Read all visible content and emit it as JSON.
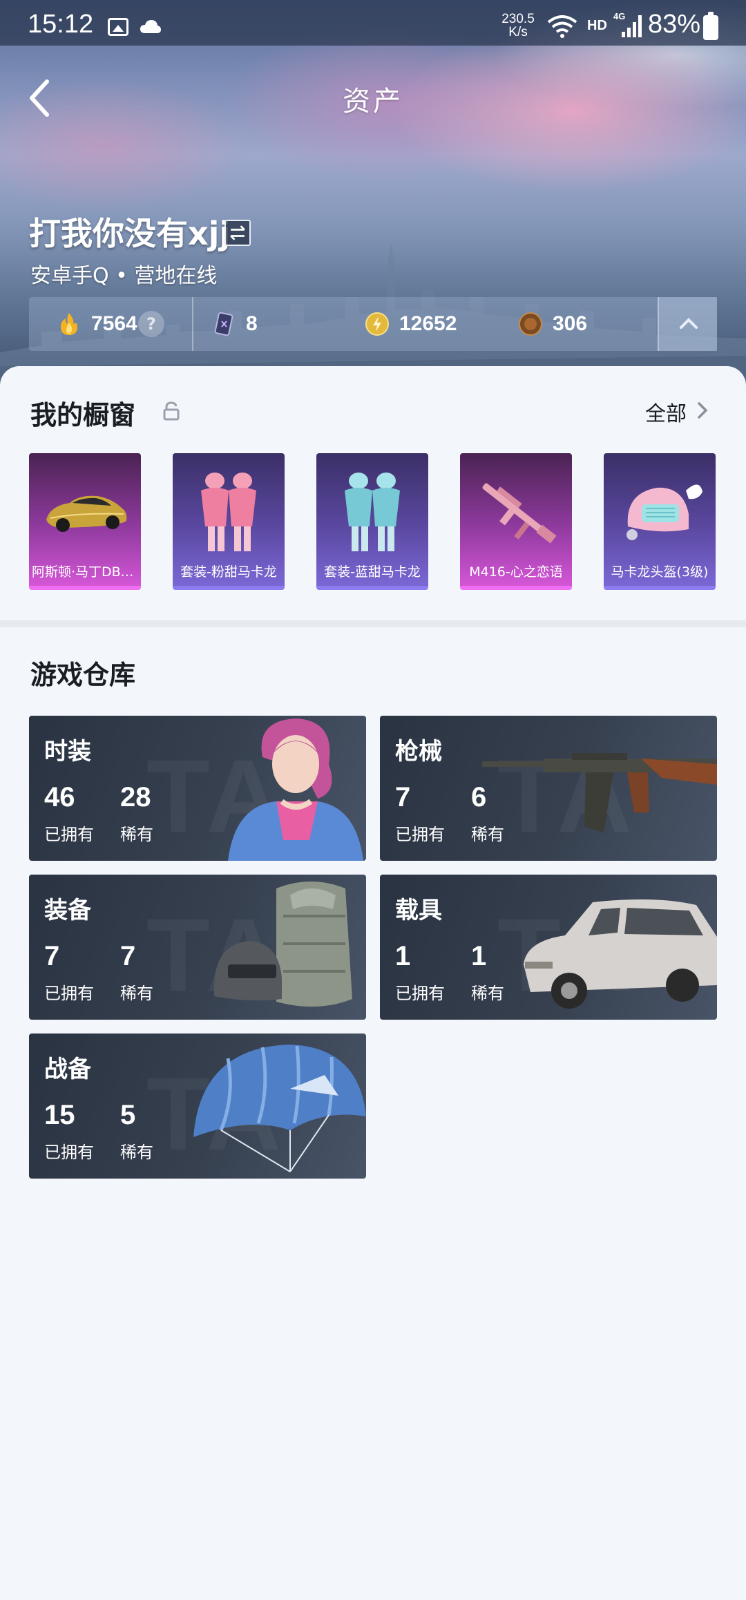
{
  "status_bar": {
    "time": "15:12",
    "speed_value": "230.5",
    "speed_unit": "K/s",
    "network_hd": "HD",
    "network_type": "4G",
    "battery": "83%"
  },
  "header": {
    "title": "资产",
    "back_icon": "chevron-left-icon"
  },
  "profile": {
    "name": "打我你没有xjj",
    "subtitle": "安卓手Q • 营地在线",
    "switch_icon": "switch-icon"
  },
  "resources": [
    {
      "icon": "flame-coin-icon",
      "value": "7564",
      "help": "?"
    },
    {
      "icon": "card-icon",
      "value": "8"
    },
    {
      "icon": "gold-coin-icon",
      "value": "12652"
    },
    {
      "icon": "bronze-coin-icon",
      "value": "306"
    }
  ],
  "showcase": {
    "title": "我的橱窗",
    "see_all": "全部",
    "items": [
      {
        "label": "阿斯顿·马丁DBS...",
        "rarity": "pink",
        "icon": "car-icon"
      },
      {
        "label": "套装-粉甜马卡龙",
        "rarity": "purple",
        "icon": "pink-outfit-icon"
      },
      {
        "label": "套装-蓝甜马卡龙",
        "rarity": "purple",
        "icon": "blue-outfit-icon"
      },
      {
        "label": "M416-心之恋语",
        "rarity": "pink",
        "icon": "rifle-icon"
      },
      {
        "label": "马卡龙头盔(3级)",
        "rarity": "purple",
        "icon": "helmet-icon"
      }
    ]
  },
  "warehouse": {
    "title": "游戏仓库",
    "owned_label": "已拥有",
    "rare_label": "稀有",
    "categories": [
      {
        "name": "时装",
        "owned": "46",
        "rare": "28"
      },
      {
        "name": "枪械",
        "owned": "7",
        "rare": "6"
      },
      {
        "name": "装备",
        "owned": "7",
        "rare": "7"
      },
      {
        "name": "载具",
        "owned": "1",
        "rare": "1"
      },
      {
        "name": "战备",
        "owned": "15",
        "rare": "5"
      }
    ]
  },
  "colors": {
    "background": "#f3f6fa",
    "rarity_pink": "#f06ef3",
    "rarity_purple": "#8d7cf0",
    "card_dark": "#2a3342"
  }
}
